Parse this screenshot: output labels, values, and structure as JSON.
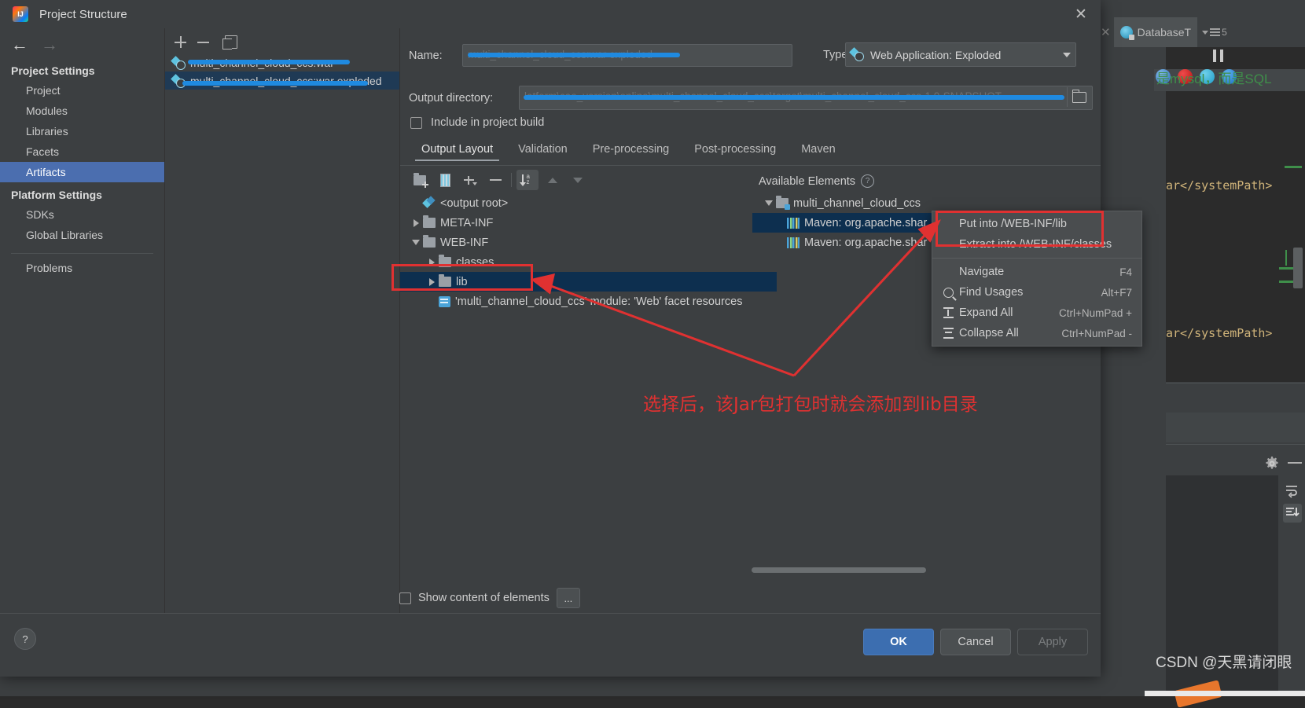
{
  "ide": {
    "tab_label": "DatabaseT",
    "tab_count": "5",
    "code_comment_cn": "是mysql，而是SQL",
    "code_line_1": "ar</systemPath>",
    "code_line_2": "ar</systemPath>",
    "watermark": "CSDN @天黑请闭眼"
  },
  "dialog": {
    "title": "Project Structure",
    "close_label": "✕"
  },
  "sidebar": {
    "back_label": "←",
    "forward_label": "→",
    "groups": [
      {
        "title": "Project Settings",
        "items": [
          {
            "label": "Project",
            "selected": false
          },
          {
            "label": "Modules",
            "selected": false
          },
          {
            "label": "Libraries",
            "selected": false
          },
          {
            "label": "Facets",
            "selected": false
          },
          {
            "label": "Artifacts",
            "selected": true
          }
        ]
      },
      {
        "title": "Platform Settings",
        "items": [
          {
            "label": "SDKs",
            "selected": false
          },
          {
            "label": "Global Libraries",
            "selected": false
          }
        ]
      }
    ],
    "problems_label": "Problems"
  },
  "artifacts": {
    "toolbar": {
      "add": "+",
      "remove": "−",
      "copy": "copy"
    },
    "items": [
      {
        "label": "multi_channel_cloud_ccs:war",
        "selected": false
      },
      {
        "label": "multi_channel_cloud_ccs:war exploded",
        "selected": true
      }
    ]
  },
  "form": {
    "name_label": "Name:",
    "name_value": "multi_channel_cloud_ccs:war exploded",
    "type_label": "Type:",
    "type_value": "Web Application: Exploded",
    "output_dir_label": "Output directory:",
    "output_dir_value": "latform\\cae_version\\online\\multi_channel_cloud_ccs\\target\\multi_channel_cloud_ccs-1.0-SNAPSHOT",
    "include_in_build_label": "Include in project build",
    "include_in_build_checked": false
  },
  "tabs": [
    {
      "label": "Output Layout",
      "active": true
    },
    {
      "label": "Validation",
      "active": false
    },
    {
      "label": "Pre-processing",
      "active": false
    },
    {
      "label": "Post-processing",
      "active": false
    },
    {
      "label": "Maven",
      "active": false
    }
  ],
  "layout_toolbar": [
    {
      "name": "create-directory",
      "active": false
    },
    {
      "name": "create-archive",
      "active": false
    },
    {
      "name": "add-copy-of",
      "active": false
    },
    {
      "name": "remove",
      "active": false
    },
    {
      "name": "sort-alphabetically",
      "active": true
    },
    {
      "name": "move-up",
      "active": false
    },
    {
      "name": "move-down",
      "active": false
    }
  ],
  "output_tree": [
    {
      "label": "<output root>",
      "icon": "artifact-diamond",
      "indent": 0,
      "twisty": "none",
      "selected": false
    },
    {
      "label": "META-INF",
      "icon": "folder",
      "indent": 0,
      "twisty": "collapsed",
      "selected": false
    },
    {
      "label": "WEB-INF",
      "icon": "folder",
      "indent": 0,
      "twisty": "expanded",
      "selected": false
    },
    {
      "label": "classes",
      "icon": "folder",
      "indent": 1,
      "twisty": "collapsed",
      "selected": false
    },
    {
      "label": "lib",
      "icon": "folder",
      "indent": 1,
      "twisty": "collapsed",
      "selected": true
    },
    {
      "label": "'multi_channel_cloud_ccs' module: 'Web' facet resources",
      "icon": "facet",
      "indent": 1,
      "twisty": "none",
      "selected": false
    }
  ],
  "available": {
    "header": "Available Elements",
    "help_glyph": "?",
    "tree": [
      {
        "label": "multi_channel_cloud_ccs",
        "icon": "module-folder",
        "indent": 0,
        "twisty": "expanded",
        "selected": false
      },
      {
        "label": "Maven: org.apache.shar",
        "icon": "library",
        "indent": 1,
        "twisty": "none",
        "selected": true
      },
      {
        "label": "Maven: org.apache.shar",
        "icon": "library",
        "indent": 1,
        "twisty": "none",
        "selected": false
      }
    ]
  },
  "context_menu": [
    {
      "label": "Put into /WEB-INF/lib",
      "shortcut": "",
      "icon": "none",
      "highlighted": true
    },
    {
      "label": "Extract into /WEB-INF/classes",
      "shortcut": "",
      "icon": "none",
      "highlighted": false
    },
    {
      "separator": true
    },
    {
      "label": "Navigate",
      "shortcut": "F4",
      "icon": "none",
      "highlighted": false
    },
    {
      "label": "Find Usages",
      "shortcut": "Alt+F7",
      "icon": "search-icon",
      "highlighted": false
    },
    {
      "label": "Expand All",
      "shortcut": "Ctrl+NumPad +",
      "icon": "expand-all-icon",
      "highlighted": false
    },
    {
      "label": "Collapse All",
      "shortcut": "Ctrl+NumPad -",
      "icon": "collapse-all-icon",
      "highlighted": false
    }
  ],
  "bottom": {
    "show_content_label": "Show content of elements",
    "show_content_checked": false,
    "ellipsis_label": "...",
    "help_label": "?",
    "ok_label": "OK",
    "cancel_label": "Cancel",
    "apply_label": "Apply"
  },
  "annotation": {
    "text_cn": "选择后，该Jar包打包时就会添加到lib目录",
    "color": "#e03131"
  },
  "colors": {
    "accent_blue": "#4b6eaf",
    "selection_tree": "#0d2f4f",
    "annotation_red": "#e03131",
    "redaction_blue": "#1f8ae0",
    "panel_bg": "#3c3f41",
    "ok_button": "#3c6eb0"
  }
}
